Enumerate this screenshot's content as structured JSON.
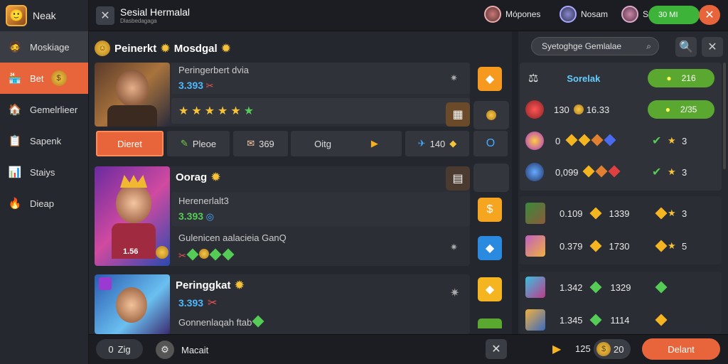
{
  "sidebar": {
    "user": "Neak",
    "items": [
      {
        "label": "Moskiage",
        "icon": "avatar-icon"
      },
      {
        "label": "Bet",
        "icon": "shop-icon"
      },
      {
        "label": "Gemelrlieer",
        "icon": "home-icon"
      },
      {
        "label": "Sapenk",
        "icon": "list-icon"
      },
      {
        "label": "Staiys",
        "icon": "chart-icon"
      },
      {
        "label": "Dieap",
        "icon": "fire-icon"
      }
    ]
  },
  "header": {
    "title": "Sesial Hermalal",
    "subtitle": "Dlasbedagaga",
    "players": [
      "Mópones",
      "Nosam",
      "S"
    ],
    "green_btn": "30 MI"
  },
  "main": {
    "heading_left": "Peinerkt",
    "heading": "Mosdgal",
    "card1": {
      "title": "Peringerbert dvia",
      "price": "3.393"
    },
    "tabs": [
      "Dieret",
      "Pleoe",
      "369",
      "Oitg",
      "140"
    ],
    "card2": {
      "title": "Oorag",
      "line1": "Herenerlalt3",
      "price": "3.393",
      "line2": "Gulenicen aalacieia GanQ",
      "badge": "1.56"
    },
    "card3": {
      "title": "Peringgkat",
      "price": "3.393",
      "line2": "Gonnenlaqah ftab"
    }
  },
  "right": {
    "search": "Syetoghge Gemlalae",
    "sort_label": "Sorelak",
    "pill1": "216",
    "row1": {
      "a": "130",
      "b": "16.33",
      "pill": "2/35"
    },
    "row2": {
      "a": "0",
      "c": "3"
    },
    "row3": {
      "a": "0,099",
      "c": "3"
    },
    "row4": {
      "a": "0.109",
      "b": "1339",
      "c": "3"
    },
    "row5": {
      "a": "0.379",
      "b": "1730",
      "c": "5"
    },
    "row6": {
      "a": "1.342",
      "b": "1329"
    },
    "row7": {
      "a": "1.345",
      "b": "1114"
    }
  },
  "bottom": {
    "left_pill": "Zig",
    "left_pill_icon_text": "0",
    "label": "Macait",
    "count1": "125",
    "count2": "20",
    "action": "Delant"
  }
}
